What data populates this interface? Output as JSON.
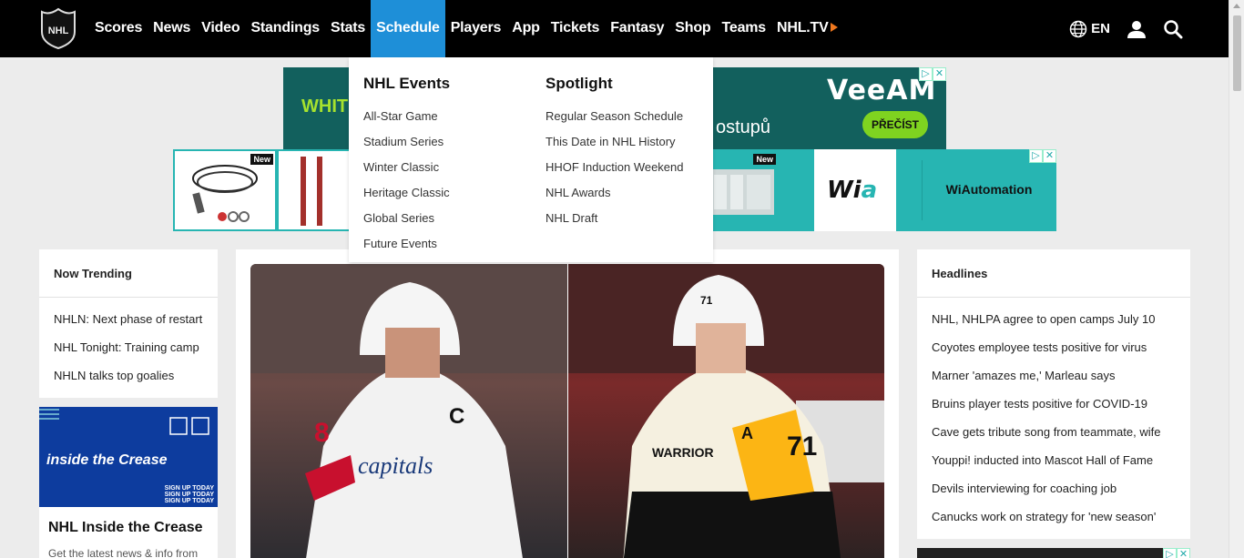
{
  "nav": {
    "logo_label": "NHL",
    "items": [
      {
        "label": "Scores"
      },
      {
        "label": "News"
      },
      {
        "label": "Video"
      },
      {
        "label": "Standings"
      },
      {
        "label": "Stats"
      },
      {
        "label": "Schedule",
        "active": true
      },
      {
        "label": "Players"
      },
      {
        "label": "App"
      },
      {
        "label": "Tickets"
      },
      {
        "label": "Fantasy"
      },
      {
        "label": "Shop"
      },
      {
        "label": "Teams"
      },
      {
        "label": "NHL.TV"
      }
    ],
    "language": "EN",
    "icons": {
      "language": "globe-icon",
      "account": "user-icon",
      "search": "search-icon",
      "nhltv": "play-triangle-icon"
    },
    "active_color": "#1e8fd8"
  },
  "dropdown": {
    "columns": [
      {
        "heading": "NHL Events",
        "items": [
          "All-Star Game",
          "Stadium Series",
          "Winter Classic",
          "Heritage Classic",
          "Global Series",
          "Future Events"
        ]
      },
      {
        "heading": "Spotlight",
        "items": [
          "Regular Season Schedule",
          "This Date in NHL History",
          "HHOF Induction Weekend",
          "NHL Awards",
          "NHL Draft"
        ]
      }
    ]
  },
  "ads": {
    "top": {
      "left_text": "WHIT",
      "mid_text": "ostupů",
      "brand": "VeeAM",
      "cta": "PŘEČÍST"
    },
    "second": {
      "new_label": "New",
      "brand": "WiAutomation",
      "logo_text": "Wi",
      "logo_accent": "a"
    }
  },
  "trending": {
    "title": "Now Trending",
    "items": [
      "NHLN: Next phase of restart",
      "NHL Tonight: Training camp",
      "NHLN talks top goalies"
    ]
  },
  "crease": {
    "ad_title": "inside the Crease",
    "ad_sign": [
      "SIGN UP TODAY",
      "SIGN UP TODAY",
      "SIGN UP TODAY"
    ],
    "card_title": "NHL Inside the Crease",
    "card_sub": "Get the latest news & info from"
  },
  "headlines": {
    "title": "Headlines",
    "items": [
      "NHL, NHLPA agree to open camps July 10",
      "Coyotes employee tests positive for virus",
      "Marner 'amazes me,' Marleau says",
      "Bruins player tests positive for COVID-19",
      "Cave gets tribute song from teammate, wife",
      "Youppi! inducted into Mascot Hall of Fame",
      "Devils interviewing for coaching job",
      "Canucks work on strategy for 'new season'"
    ]
  },
  "hero": {
    "left_jersey_number": "8",
    "left_jersey_letter": "C",
    "left_team_text": "capitals",
    "right_jersey_number": "71",
    "right_jersey_letter": "A",
    "right_brand": "WARRIOR",
    "right_helmet_number": "71"
  }
}
